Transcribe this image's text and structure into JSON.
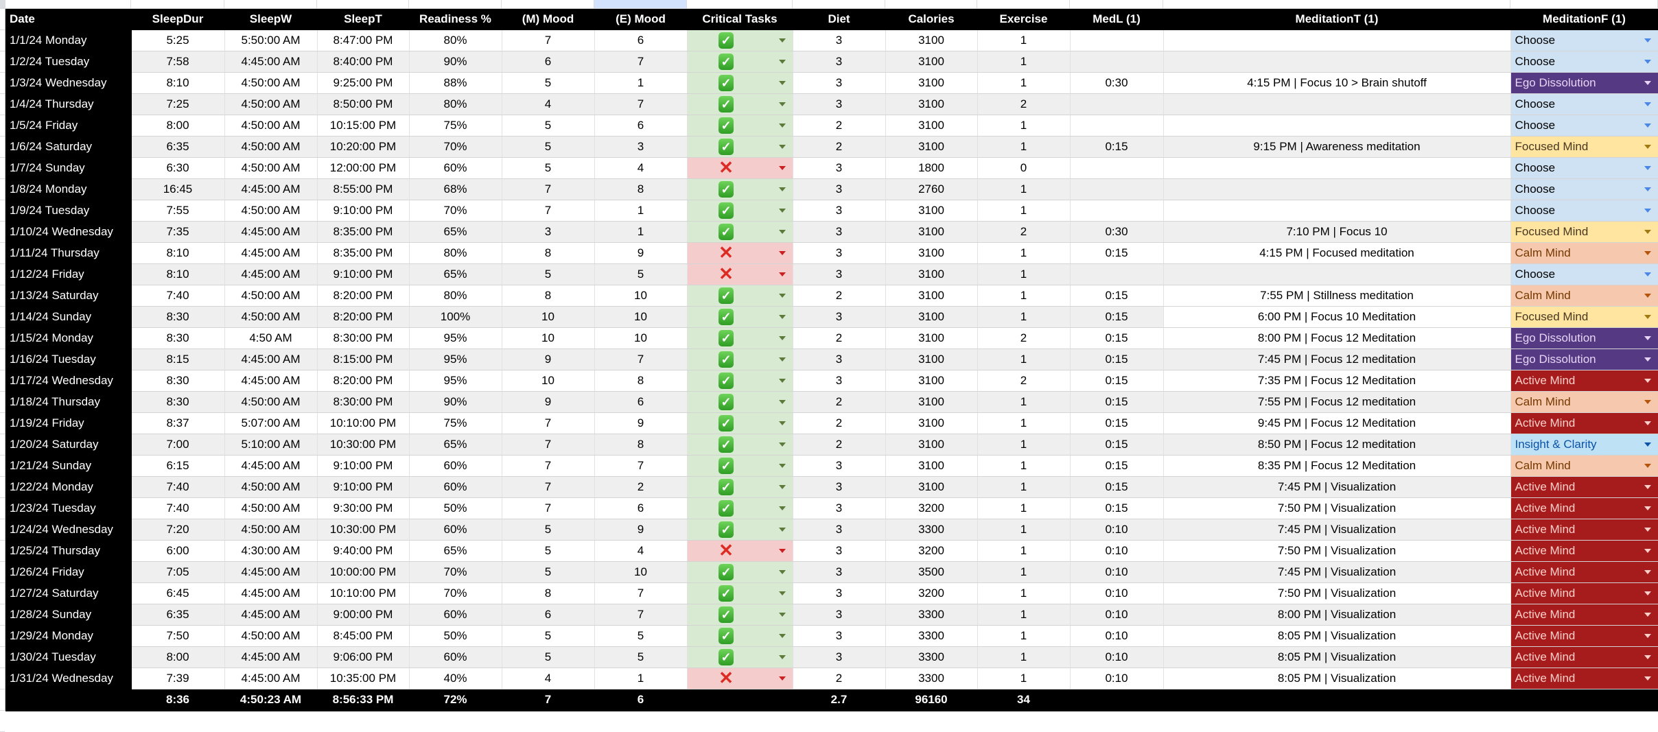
{
  "sheet": {
    "selected_column_index": 6,
    "headers": [
      "Date",
      "SleepDur",
      "SleepW",
      "SleepT",
      "Readiness %",
      "(M) Mood",
      "(E) Mood",
      "Critical Tasks",
      "Diet",
      "Calories",
      "Exercise",
      "MedL (1)",
      "MeditationT (1)",
      "MeditationF (1)"
    ],
    "critical_icons": {
      "done": "✓",
      "missed": "✕"
    },
    "meditation_focus_styles": {
      "Choose": {
        "bg": "#cfe2f3",
        "fg": "#000000",
        "arrow": "#4a86e8"
      },
      "Ego Dissolution": {
        "bg": "#553982",
        "fg": "#e6d6f7",
        "arrow": "#e6d6f7"
      },
      "Focused Mind": {
        "bg": "#ffe5a0",
        "fg": "#473821",
        "arrow": "#a07a10"
      },
      "Calm Mind": {
        "bg": "#f6c9ae",
        "fg": "#753800",
        "arrow": "#b45309"
      },
      "Active Mind": {
        "bg": "#a61c1c",
        "fg": "#ffcfc9",
        "arrow": "#ffcfc9"
      },
      "Insight & Clarity": {
        "bg": "#bfe1f6",
        "fg": "#0a53a8",
        "arrow": "#0a53a8"
      }
    },
    "rows": [
      {
        "date": "1/1/24 Monday",
        "sleepdur": "5:25",
        "sleepw": "5:50:00 AM",
        "sleept": "8:47:00 PM",
        "readiness": "80%",
        "mmood": "7",
        "emood": "6",
        "critical": "done",
        "diet": "3",
        "calories": "3100",
        "exercise": "1",
        "medl": "",
        "medt": "",
        "medf": "Choose"
      },
      {
        "date": "1/2/24 Tuesday",
        "sleepdur": "7:58",
        "sleepw": "4:45:00 AM",
        "sleept": "8:40:00 PM",
        "readiness": "90%",
        "mmood": "6",
        "emood": "7",
        "critical": "done",
        "diet": "3",
        "calories": "3100",
        "exercise": "1",
        "medl": "",
        "medt": "",
        "medf": "Choose"
      },
      {
        "date": "1/3/24 Wednesday",
        "sleepdur": "8:10",
        "sleepw": "4:50:00 AM",
        "sleept": "9:25:00 PM",
        "readiness": "88%",
        "mmood": "5",
        "emood": "1",
        "critical": "done",
        "diet": "3",
        "calories": "3100",
        "exercise": "1",
        "medl": "0:30",
        "medt": "4:15 PM | Focus 10 > Brain shutoff",
        "medf": "Ego Dissolution"
      },
      {
        "date": "1/4/24 Thursday",
        "sleepdur": "7:25",
        "sleepw": "4:50:00 AM",
        "sleept": "8:50:00 PM",
        "readiness": "80%",
        "mmood": "4",
        "emood": "7",
        "critical": "done",
        "diet": "3",
        "calories": "3100",
        "exercise": "2",
        "medl": "",
        "medt": "",
        "medf": "Choose"
      },
      {
        "date": "1/5/24 Friday",
        "sleepdur": "8:00",
        "sleepw": "4:50:00 AM",
        "sleept": "10:15:00 PM",
        "readiness": "75%",
        "mmood": "5",
        "emood": "6",
        "critical": "done",
        "diet": "2",
        "calories": "3100",
        "exercise": "1",
        "medl": "",
        "medt": "",
        "medf": "Choose"
      },
      {
        "date": "1/6/24 Saturday",
        "sleepdur": "6:35",
        "sleepw": "4:50:00 AM",
        "sleept": "10:20:00 PM",
        "readiness": "70%",
        "mmood": "5",
        "emood": "3",
        "critical": "done",
        "diet": "2",
        "calories": "3100",
        "exercise": "1",
        "medl": "0:15",
        "medt": "9:15 PM | Awareness meditation",
        "medf": "Focused Mind"
      },
      {
        "date": "1/7/24 Sunday",
        "sleepdur": "6:30",
        "sleepw": "4:50:00 AM",
        "sleept": "12:00:00 PM",
        "readiness": "60%",
        "mmood": "5",
        "emood": "4",
        "critical": "missed",
        "diet": "3",
        "calories": "1800",
        "exercise": "0",
        "medl": "",
        "medt": "",
        "medf": "Choose"
      },
      {
        "date": "1/8/24 Monday",
        "sleepdur": "16:45",
        "sleepw": "4:45:00 AM",
        "sleept": "8:55:00 PM",
        "readiness": "68%",
        "mmood": "7",
        "emood": "8",
        "critical": "done",
        "diet": "3",
        "calories": "2760",
        "exercise": "1",
        "medl": "",
        "medt": "",
        "medf": "Choose"
      },
      {
        "date": "1/9/24 Tuesday",
        "sleepdur": "7:55",
        "sleepw": "4:50:00 AM",
        "sleept": "9:10:00 PM",
        "readiness": "70%",
        "mmood": "7",
        "emood": "1",
        "critical": "done",
        "diet": "3",
        "calories": "3100",
        "exercise": "1",
        "medl": "",
        "medt": "",
        "medf": "Choose"
      },
      {
        "date": "1/10/24 Wednesday",
        "sleepdur": "7:35",
        "sleepw": "4:45:00 AM",
        "sleept": "8:35:00 PM",
        "readiness": "65%",
        "mmood": "3",
        "emood": "1",
        "critical": "done",
        "diet": "3",
        "calories": "3100",
        "exercise": "2",
        "medl": "0:30",
        "medt": "7:10 PM | Focus 10",
        "medf": "Focused Mind"
      },
      {
        "date": "1/11/24 Thursday",
        "sleepdur": "8:10",
        "sleepw": "4:45:00 AM",
        "sleept": "8:35:00 PM",
        "readiness": "80%",
        "mmood": "8",
        "emood": "9",
        "critical": "missed",
        "diet": "3",
        "calories": "3100",
        "exercise": "1",
        "medl": "0:15",
        "medt": "4:15 PM | Focused meditation",
        "medf": "Calm Mind"
      },
      {
        "date": "1/12/24 Friday",
        "sleepdur": "8:10",
        "sleepw": "4:45:00 AM",
        "sleept": "9:10:00 PM",
        "readiness": "65%",
        "mmood": "5",
        "emood": "5",
        "critical": "missed",
        "diet": "3",
        "calories": "3100",
        "exercise": "1",
        "medl": "",
        "medt": "",
        "medf": "Choose"
      },
      {
        "date": "1/13/24 Saturday",
        "sleepdur": "7:40",
        "sleepw": "4:50:00 AM",
        "sleept": "8:20:00 PM",
        "readiness": "80%",
        "mmood": "8",
        "emood": "10",
        "critical": "done",
        "diet": "2",
        "calories": "3100",
        "exercise": "1",
        "medl": "0:15",
        "medt": "7:55 PM | Stillness meditation",
        "medf": "Calm Mind"
      },
      {
        "date": "1/14/24 Sunday",
        "sleepdur": "8:30",
        "sleepw": "4:50:00 AM",
        "sleept": "8:20:00 PM",
        "readiness": "100%",
        "mmood": "10",
        "emood": "10",
        "critical": "done",
        "diet": "3",
        "calories": "3100",
        "exercise": "1",
        "medl": "0:15",
        "medt": "6:00 PM | Focus 10 Meditation",
        "medf": "Focused Mind",
        "medt_white": true
      },
      {
        "date": "1/15/24 Monday",
        "sleepdur": "8:30",
        "sleepw": "4:50 AM",
        "sleept": "8:30:00 PM",
        "readiness": "95%",
        "mmood": "10",
        "emood": "10",
        "critical": "done",
        "diet": "2",
        "calories": "3100",
        "exercise": "2",
        "medl": "0:15",
        "medt": "8:00 PM | Focus 12 Meditation",
        "medf": "Ego Dissolution"
      },
      {
        "date": "1/16/24 Tuesday",
        "sleepdur": "8:15",
        "sleepw": "4:45:00 AM",
        "sleept": "8:15:00 PM",
        "readiness": "95%",
        "mmood": "9",
        "emood": "7",
        "critical": "done",
        "diet": "3",
        "calories": "3100",
        "exercise": "1",
        "medl": "0:15",
        "medt": "7:45 PM | Focus 12 meditation",
        "medf": "Ego Dissolution"
      },
      {
        "date": "1/17/24 Wednesday",
        "sleepdur": "8:30",
        "sleepw": "4:45:00 AM",
        "sleept": "8:20:00 PM",
        "readiness": "95%",
        "mmood": "10",
        "emood": "8",
        "critical": "done",
        "diet": "3",
        "calories": "3100",
        "exercise": "2",
        "medl": "0:15",
        "medt": "7:35 PM | Focus 12 Meditation",
        "medf": "Active Mind"
      },
      {
        "date": "1/18/24 Thursday",
        "sleepdur": "8:30",
        "sleepw": "4:50:00 AM",
        "sleept": "8:30:00 PM",
        "readiness": "90%",
        "mmood": "9",
        "emood": "6",
        "critical": "done",
        "diet": "2",
        "calories": "3100",
        "exercise": "1",
        "medl": "0:15",
        "medt": "7:55 PM | Focus 12 meditation",
        "medf": "Calm Mind"
      },
      {
        "date": "1/19/24 Friday",
        "sleepdur": "8:37",
        "sleepw": "5:07:00 AM",
        "sleept": "10:10:00 PM",
        "readiness": "75%",
        "mmood": "7",
        "emood": "9",
        "critical": "done",
        "diet": "2",
        "calories": "3100",
        "exercise": "1",
        "medl": "0:15",
        "medt": "9:45 PM | Focus 12 Meditation",
        "medf": "Active Mind"
      },
      {
        "date": "1/20/24 Saturday",
        "sleepdur": "7:00",
        "sleepw": "5:10:00 AM",
        "sleept": "10:30:00 PM",
        "readiness": "65%",
        "mmood": "7",
        "emood": "8",
        "critical": "done",
        "diet": "2",
        "calories": "3100",
        "exercise": "1",
        "medl": "0:15",
        "medt": "8:50 PM | Focus 12 meditation",
        "medf": "Insight & Clarity"
      },
      {
        "date": "1/21/24 Sunday",
        "sleepdur": "6:15",
        "sleepw": "4:45:00 AM",
        "sleept": "9:10:00 PM",
        "readiness": "60%",
        "mmood": "7",
        "emood": "7",
        "critical": "done",
        "diet": "3",
        "calories": "3100",
        "exercise": "1",
        "medl": "0:15",
        "medt": "8:35 PM | Focus 12 Meditation",
        "medf": "Calm Mind"
      },
      {
        "date": "1/22/24 Monday",
        "sleepdur": "7:40",
        "sleepw": "4:50:00 AM",
        "sleept": "9:10:00 PM",
        "readiness": "60%",
        "mmood": "7",
        "emood": "2",
        "critical": "done",
        "diet": "3",
        "calories": "3100",
        "exercise": "1",
        "medl": "0:15",
        "medt": "7:45 PM | Visualization",
        "medf": "Active Mind"
      },
      {
        "date": "1/23/24 Tuesday",
        "sleepdur": "7:40",
        "sleepw": "4:50:00 AM",
        "sleept": "9:30:00 PM",
        "readiness": "50%",
        "mmood": "7",
        "emood": "6",
        "critical": "done",
        "diet": "3",
        "calories": "3200",
        "exercise": "1",
        "medl": "0:15",
        "medt": "7:50 PM | Visualization",
        "medf": "Active Mind"
      },
      {
        "date": "1/24/24 Wednesday",
        "sleepdur": "7:20",
        "sleepw": "4:50:00 AM",
        "sleept": "10:30:00 PM",
        "readiness": "60%",
        "mmood": "5",
        "emood": "9",
        "critical": "done",
        "diet": "3",
        "calories": "3300",
        "exercise": "1",
        "medl": "0:10",
        "medt": "7:45 PM | Visualization",
        "medf": "Active Mind"
      },
      {
        "date": "1/25/24 Thursday",
        "sleepdur": "6:00",
        "sleepw": "4:30:00 AM",
        "sleept": "9:40:00 PM",
        "readiness": "65%",
        "mmood": "5",
        "emood": "4",
        "critical": "missed",
        "diet": "3",
        "calories": "3200",
        "exercise": "1",
        "medl": "0:10",
        "medt": "7:50 PM | Visualization",
        "medf": "Active Mind"
      },
      {
        "date": "1/26/24 Friday",
        "sleepdur": "7:05",
        "sleepw": "4:45:00 AM",
        "sleept": "10:00:00 PM",
        "readiness": "70%",
        "mmood": "5",
        "emood": "10",
        "critical": "done",
        "diet": "3",
        "calories": "3500",
        "exercise": "1",
        "medl": "0:10",
        "medt": "7:45 PM | Visualization",
        "medf": "Active Mind"
      },
      {
        "date": "1/27/24 Saturday",
        "sleepdur": "6:45",
        "sleepw": "4:45:00 AM",
        "sleept": "10:10:00 PM",
        "readiness": "70%",
        "mmood": "8",
        "emood": "7",
        "critical": "done",
        "diet": "3",
        "calories": "3200",
        "exercise": "1",
        "medl": "0:10",
        "medt": "7:50 PM | Visualization",
        "medf": "Active Mind"
      },
      {
        "date": "1/28/24 Sunday",
        "sleepdur": "6:35",
        "sleepw": "4:45:00 AM",
        "sleept": "9:00:00 PM",
        "readiness": "60%",
        "mmood": "6",
        "emood": "7",
        "critical": "done",
        "diet": "3",
        "calories": "3300",
        "exercise": "1",
        "medl": "0:10",
        "medt": "8:00 PM | Visualization",
        "medf": "Active Mind"
      },
      {
        "date": "1/29/24 Monday",
        "sleepdur": "7:50",
        "sleepw": "4:50:00 AM",
        "sleept": "8:45:00 PM",
        "readiness": "50%",
        "mmood": "5",
        "emood": "5",
        "critical": "done",
        "diet": "3",
        "calories": "3300",
        "exercise": "1",
        "medl": "0:10",
        "medt": "8:05 PM | Visualization",
        "medf": "Active Mind"
      },
      {
        "date": "1/30/24 Tuesday",
        "sleepdur": "8:00",
        "sleepw": "4:45:00 AM",
        "sleept": "9:06:00 PM",
        "readiness": "60%",
        "mmood": "5",
        "emood": "5",
        "critical": "done",
        "diet": "3",
        "calories": "3300",
        "exercise": "1",
        "medl": "0:10",
        "medt": "8:05 PM | Visualization",
        "medf": "Active Mind"
      },
      {
        "date": "1/31/24 Wednesday",
        "sleepdur": "7:39",
        "sleepw": "4:45:00 AM",
        "sleept": "10:35:00 PM",
        "readiness": "40%",
        "mmood": "4",
        "emood": "1",
        "critical": "missed",
        "diet": "2",
        "calories": "3300",
        "exercise": "1",
        "medl": "0:10",
        "medt": "8:05 PM | Visualization",
        "medf": "Active Mind"
      }
    ],
    "totals": {
      "date": "",
      "sleepdur": "8:36",
      "sleepw": "4:50:23 AM",
      "sleept": "8:56:33 PM",
      "readiness": "72%",
      "mmood": "7",
      "emood": "6",
      "critical": "",
      "diet": "2.7",
      "calories": "96160",
      "exercise": "34",
      "medl": "",
      "medt": "",
      "medf": ""
    }
  }
}
